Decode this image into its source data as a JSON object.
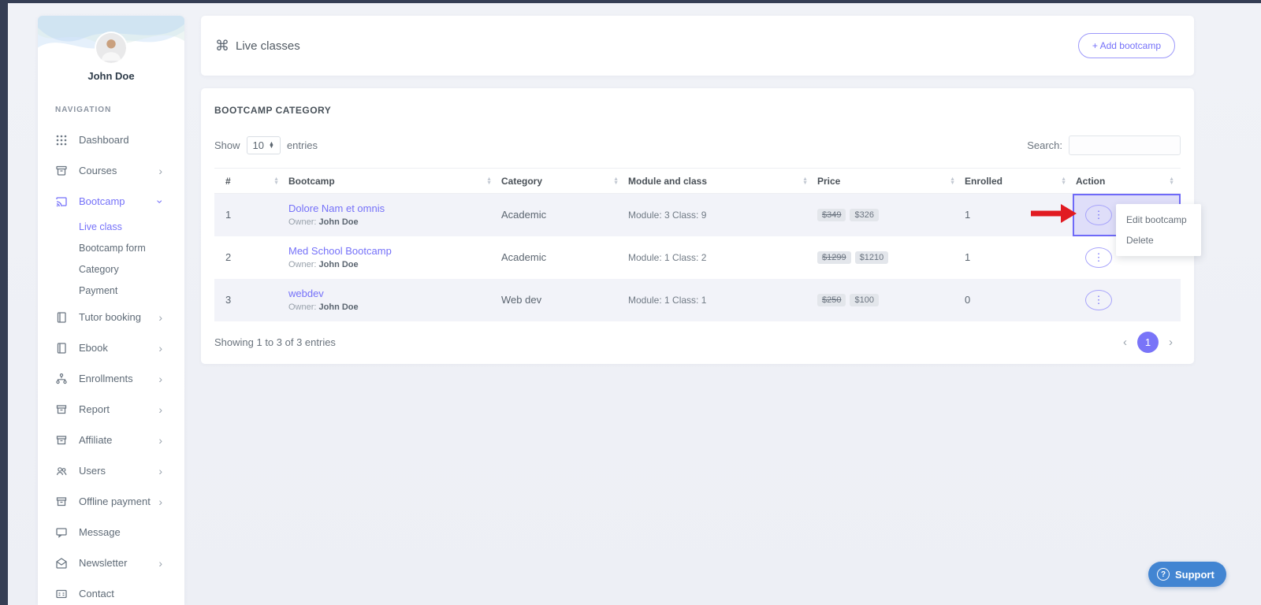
{
  "user": {
    "name": "John Doe",
    "avatar": "avatar-photo"
  },
  "sidebar": {
    "section_label": "NAVIGATION",
    "items": [
      {
        "label": "Dashboard",
        "icon": "grid-icon",
        "chevron": null,
        "active": false
      },
      {
        "label": "Courses",
        "icon": "archive-icon",
        "chevron": "right",
        "active": false
      },
      {
        "label": "Bootcamp",
        "icon": "cast-icon",
        "chevron": "down",
        "active": true,
        "children": [
          {
            "label": "Live class",
            "active": true
          },
          {
            "label": "Bootcamp form",
            "active": false
          },
          {
            "label": "Category",
            "active": false
          },
          {
            "label": "Payment",
            "active": false
          }
        ]
      },
      {
        "label": "Tutor booking",
        "icon": "book-icon",
        "chevron": "right",
        "active": false
      },
      {
        "label": "Ebook",
        "icon": "book-icon",
        "chevron": "right",
        "active": false
      },
      {
        "label": "Enrollments",
        "icon": "sitemap-icon",
        "chevron": "right",
        "active": false
      },
      {
        "label": "Report",
        "icon": "box-icon",
        "chevron": "right",
        "active": false
      },
      {
        "label": "Affiliate",
        "icon": "box-icon",
        "chevron": "right",
        "active": false
      },
      {
        "label": "Users",
        "icon": "users-icon",
        "chevron": "right",
        "active": false
      },
      {
        "label": "Offline payment",
        "icon": "box-icon",
        "chevron": "right",
        "active": false
      },
      {
        "label": "Message",
        "icon": "chat-icon",
        "chevron": null,
        "active": false
      },
      {
        "label": "Newsletter",
        "icon": "mail-icon",
        "chevron": "right",
        "active": false
      },
      {
        "label": "Contact",
        "icon": "id-card-icon",
        "chevron": null,
        "active": false
      }
    ]
  },
  "header": {
    "icon": "command-icon",
    "title": "Live classes",
    "add_button_label": "+ Add bootcamp"
  },
  "panel": {
    "title": "BOOTCAMP CATEGORY",
    "show_label": "Show",
    "page_size": "10",
    "entries_label": "entries",
    "search_label": "Search:",
    "search_value": "",
    "table": {
      "columns": [
        "#",
        "Bootcamp",
        "Category",
        "Module and class",
        "Price",
        "Enrolled",
        "Action"
      ],
      "rows": [
        {
          "num": "1",
          "name": "Dolore Nam et omnis",
          "owner_label": "Owner:",
          "owner": "John Doe",
          "category": "Academic",
          "module": "Module: 3 Class: 9",
          "price_old": "$349",
          "price_new": "$326",
          "enrolled": "1",
          "highlighted": true
        },
        {
          "num": "2",
          "name": "Med School Bootcamp",
          "owner_label": "Owner:",
          "owner": "John Doe",
          "category": "Academic",
          "module": "Module: 1 Class: 2",
          "price_old": "$1299",
          "price_new": "$1210",
          "enrolled": "1",
          "highlighted": false
        },
        {
          "num": "3",
          "name": "webdev",
          "owner_label": "Owner:",
          "owner": "John Doe",
          "category": "Web dev",
          "module": "Module: 1 Class: 1",
          "price_old": "$250",
          "price_new": "$100",
          "enrolled": "0",
          "highlighted": false
        }
      ],
      "action_icon": "kebab-vertical-icon"
    },
    "footer": {
      "showing_text": "Showing 1 to 3 of 3 entries",
      "prev": "‹",
      "page": "1",
      "next": "›"
    }
  },
  "context_menu": {
    "items": [
      "Edit bootcamp",
      "Delete"
    ]
  },
  "annotation": {
    "type": "red-arrow",
    "points_at": "row-1 action button"
  },
  "support": {
    "icon": "question-icon",
    "label": "Support"
  },
  "colors": {
    "accent": "#7571f9",
    "dark_rail": "#353e54",
    "arrow_red": "#e11b22",
    "support_blue": "#4285d2",
    "stripe": "#f2f3f9",
    "badge_bg": "#e3e6eb"
  }
}
